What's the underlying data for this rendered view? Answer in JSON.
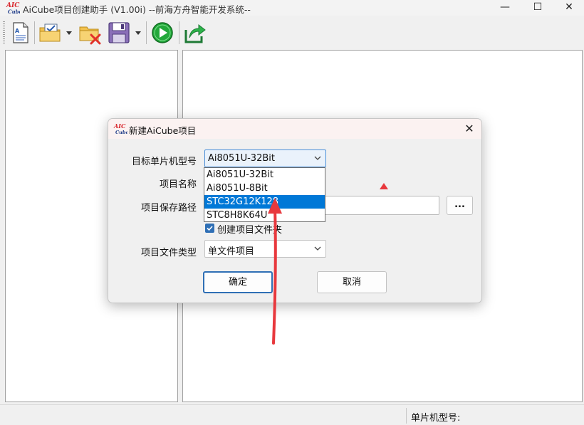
{
  "app": {
    "title": "AiCube项目创建助手 (V1.00i) --前海方舟智能开发系统--",
    "logo_text_top": "AIC",
    "logo_text_bottom": "Cube"
  },
  "window_controls": {
    "minimize": "—",
    "maximize": "☐",
    "close": "✕"
  },
  "toolbar": {
    "icons": [
      "new-document-icon",
      "open-project-icon",
      "delete-folder-icon",
      "save-icon",
      "run-icon",
      "export-icon"
    ]
  },
  "dialog": {
    "title": "新建AiCube项目",
    "close": "✕",
    "mcu_label": "目标单片机型号",
    "mcu_value": "Ai8051U-32Bit",
    "name_label": "项目名称",
    "path_label": "项目保存路径",
    "browse_label": "...",
    "create_folder_label": "创建项目文件夹",
    "filetype_label": "项目文件类型",
    "filetype_value": "单文件项目",
    "ok_label": "确定",
    "cancel_label": "取消"
  },
  "dropdown": {
    "options": [
      "Ai8051U-32Bit",
      "Ai8051U-8Bit",
      "STC32G12K128",
      "STC8H8K64U"
    ],
    "selected_index": 2
  },
  "statusbar": {
    "mcu_label": "单片机型号:"
  },
  "colors": {
    "selection": "#0078d7",
    "default_button_border": "#2f6fb5",
    "annotation_arrow": "#e8383d"
  }
}
